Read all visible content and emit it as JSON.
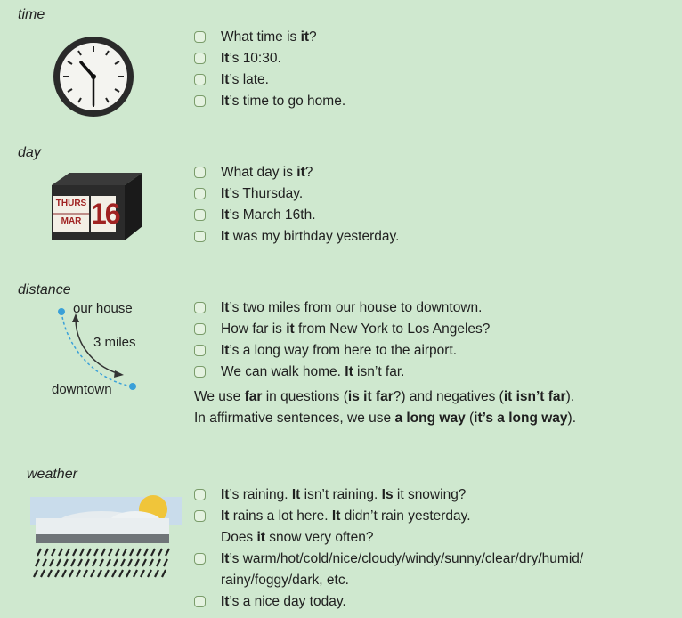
{
  "sections": [
    {
      "title": "time",
      "icon": "clock-icon",
      "items": [
        [
          {
            "t": "What time is "
          },
          {
            "t": "it",
            "b": true
          },
          {
            "t": "?"
          }
        ],
        [
          {
            "t": "It",
            "b": true
          },
          {
            "t": "’s 10:30."
          }
        ],
        [
          {
            "t": "It",
            "b": true
          },
          {
            "t": "’s late."
          }
        ],
        [
          {
            "t": "It",
            "b": true
          },
          {
            "t": "’s time to go home."
          }
        ]
      ]
    },
    {
      "title": "day",
      "icon": "calendar-icon",
      "calendar": {
        "day": "THURS",
        "month": "MAR",
        "date": "16"
      },
      "items": [
        [
          {
            "t": "What day is "
          },
          {
            "t": "it",
            "b": true
          },
          {
            "t": "?"
          }
        ],
        [
          {
            "t": "It",
            "b": true
          },
          {
            "t": "’s Thursday."
          }
        ],
        [
          {
            "t": "It",
            "b": true
          },
          {
            "t": "’s March 16th."
          }
        ],
        [
          {
            "t": "It",
            "b": true
          },
          {
            "t": " was my birthday yesterday."
          }
        ]
      ]
    },
    {
      "title": "distance",
      "icon": "distance-icon",
      "labels": {
        "from": "our house",
        "distance": "3 miles",
        "to": "downtown"
      },
      "items": [
        [
          {
            "t": "It",
            "b": true
          },
          {
            "t": "’s two miles from our house to downtown."
          }
        ],
        [
          {
            "t": "How far is "
          },
          {
            "t": "it",
            "b": true
          },
          {
            "t": " from New York to Los Angeles?"
          }
        ],
        [
          {
            "t": "It",
            "b": true
          },
          {
            "t": "’s a long way from here to the airport."
          }
        ],
        [
          {
            "t": "We can walk home.  "
          },
          {
            "t": "It",
            "b": true
          },
          {
            "t": " isn’t far."
          }
        ]
      ],
      "note": [
        [
          {
            "t": "We use "
          },
          {
            "t": "far",
            "b": true
          },
          {
            "t": " in questions ("
          },
          {
            "t": "is it far",
            "b": true
          },
          {
            "t": "?) and negatives ("
          },
          {
            "t": "it isn’t far",
            "b": true
          },
          {
            "t": ")."
          }
        ],
        [
          {
            "t": "In affirmative sentences, we use "
          },
          {
            "t": "a long way",
            "b": true
          },
          {
            "t": " ("
          },
          {
            "t": "it’s a long way",
            "b": true
          },
          {
            "t": ")."
          }
        ]
      ]
    },
    {
      "title": "weather",
      "icon": "weather-icon",
      "items": [
        [
          {
            "t": "It",
            "b": true
          },
          {
            "t": "’s raining.  "
          },
          {
            "t": "It",
            "b": true
          },
          {
            "t": " isn’t raining.  "
          },
          {
            "t": "Is",
            "b": true
          },
          {
            "t": " it snowing?"
          }
        ],
        [
          {
            "t": "It",
            "b": true
          },
          {
            "t": " rains a lot here.  "
          },
          {
            "t": "It",
            "b": true
          },
          {
            "t": " didn’t rain yesterday."
          }
        ],
        [
          {
            "t": "Does "
          },
          {
            "t": "it",
            "b": true
          },
          {
            "t": " snow very often?",
            "cont": true
          }
        ],
        [
          {
            "t": "It",
            "b": true
          },
          {
            "t": "’s warm/hot/cold/nice/cloudy/windy/sunny/clear/dry/humid/"
          }
        ],
        [
          {
            "t": "rainy/foggy/dark, etc.",
            "cont": true
          }
        ],
        [
          {
            "t": "It",
            "b": true
          },
          {
            "t": "’s a nice day today."
          }
        ]
      ]
    }
  ]
}
